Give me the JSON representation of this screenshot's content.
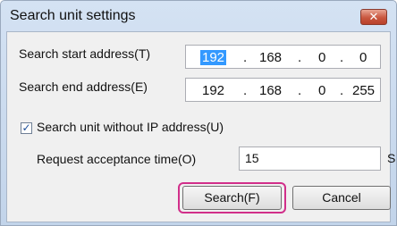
{
  "window": {
    "title": "Search unit settings",
    "close_glyph": "✕"
  },
  "fields": {
    "start_label": "Search start address(T)",
    "start_ip": [
      "192",
      "168",
      "0",
      "0"
    ],
    "end_label": "Search end address(E)",
    "end_ip": [
      "192",
      "168",
      "0",
      "255"
    ],
    "ip_separator": ".",
    "checkbox_label": "Search unit without IP address(U)",
    "checkbox_checked": true,
    "checkbox_mark": "✓",
    "timeout_label": "Request acceptance time(O)",
    "timeout_value": "15",
    "timeout_unit": "S"
  },
  "buttons": {
    "search": "Search(F)",
    "cancel": "Cancel"
  },
  "colors": {
    "highlight": "#d12f8a",
    "selection": "#3399ff"
  }
}
